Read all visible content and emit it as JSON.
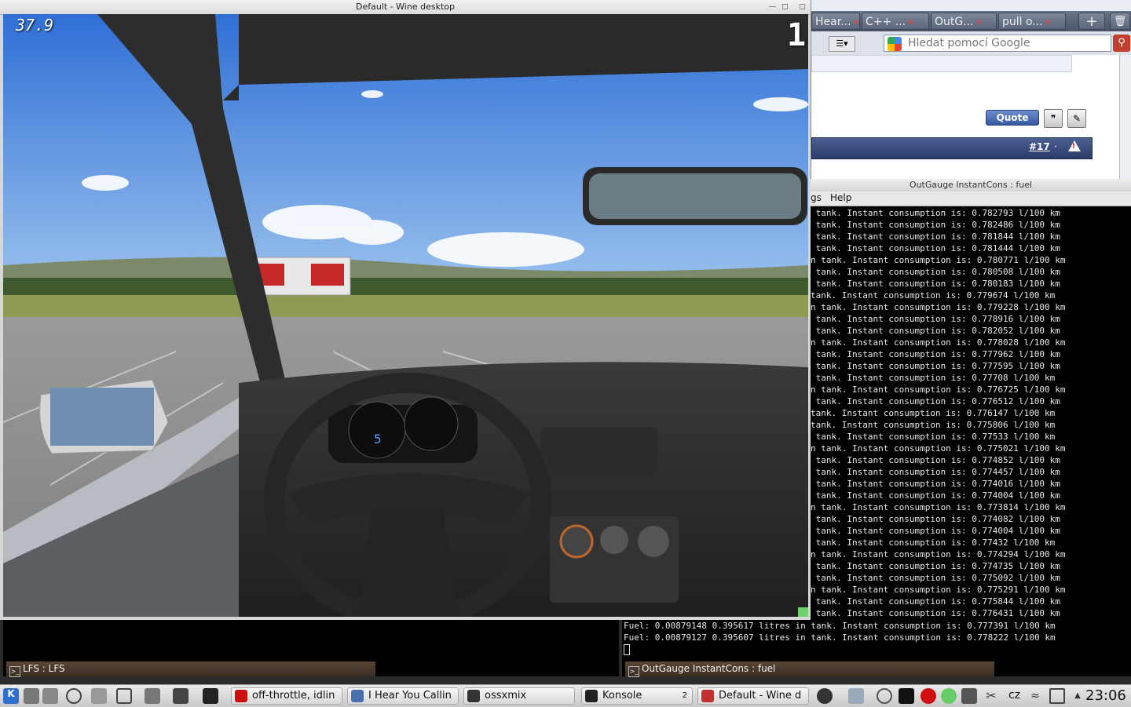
{
  "wine": {
    "title": "Default - Wine desktop",
    "hud": {
      "fps": "37.9",
      "gear_top": "1",
      "gear_dash": "5"
    }
  },
  "browser": {
    "tabs": [
      "Hear...",
      "C++ ...",
      "OutG...",
      "pull o..."
    ],
    "search_placeholder": "Hledat pomocí Google",
    "quote_label": "Quote",
    "post_number": "#17",
    "post_sep": "·"
  },
  "konsole": {
    "title": "OutGauge InstantCons : fuel",
    "menu": [
      "gs",
      "Help"
    ],
    "lines": [
      " tank. Instant consumption is: 0.782793 l/100 km",
      " tank. Instant consumption is: 0.782486 l/100 km",
      " tank. Instant consumption is: 0.781844 l/100 km",
      " tank. Instant consumption is: 0.781444 l/100 km",
      "n tank. Instant consumption is: 0.780771 l/100 km",
      " tank. Instant consumption is: 0.780508 l/100 km",
      " tank. Instant consumption is: 0.780183 l/100 km",
      "tank. Instant consumption is: 0.779674 l/100 km",
      "n tank. Instant consumption is: 0.779228 l/100 km",
      " tank. Instant consumption is: 0.778916 l/100 km",
      " tank. Instant consumption is: 0.782052 l/100 km",
      "n tank. Instant consumption is: 0.778028 l/100 km",
      " tank. Instant consumption is: 0.777962 l/100 km",
      " tank. Instant consumption is: 0.777595 l/100 km",
      " tank. Instant consumption is: 0.77708 l/100 km",
      "n tank. Instant consumption is: 0.776725 l/100 km",
      " tank. Instant consumption is: 0.776512 l/100 km",
      "tank. Instant consumption is: 0.776147 l/100 km",
      "tank. Instant consumption is: 0.775806 l/100 km",
      " tank. Instant consumption is: 0.77533 l/100 km",
      "n tank. Instant consumption is: 0.775021 l/100 km",
      " tank. Instant consumption is: 0.774852 l/100 km",
      " tank. Instant consumption is: 0.774457 l/100 km",
      " tank. Instant consumption is: 0.774016 l/100 km",
      " tank. Instant consumption is: 0.774004 l/100 km",
      "n tank. Instant consumption is: 0.773814 l/100 km",
      " tank. Instant consumption is: 0.774082 l/100 km",
      " tank. Instant consumption is: 0.774004 l/100 km",
      " tank. Instant consumption is: 0.77432 l/100 km",
      "n tank. Instant consumption is: 0.774294 l/100 km",
      " tank. Instant consumption is: 0.774735 l/100 km",
      " tank. Instant consumption is: 0.775092 l/100 km",
      "n tank. Instant consumption is: 0.775291 l/100 km",
      " tank. Instant consumption is: 0.775844 l/100 km",
      " tank. Instant consumption is: 0.776431 l/100 km"
    ]
  },
  "term_right": {
    "lines": [
      "Fuel: 0.00879148 0.395617 litres in tank. Instant consumption is: 0.777391 l/100 km",
      "Fuel: 0.00879127 0.395607 litres in tank. Instant consumption is: 0.778222 l/100 km"
    ],
    "tab_label": "OutGauge InstantCons : fuel"
  },
  "term_left": {
    "tab_label": "LFS : LFS"
  },
  "taskbar": {
    "tasks": [
      {
        "label": "off-throttle, idlin",
        "icon_color": "#cc1010"
      },
      {
        "label": "I Hear You Callin",
        "icon_color": "#4a6fb0"
      },
      {
        "label": "ossxmix",
        "icon_color": "#333333"
      },
      {
        "label": "Konsole",
        "icon_color": "#222222",
        "count": "2"
      },
      {
        "label": "Default - Wine d",
        "icon_color": "#c03030"
      }
    ],
    "lang": "cz",
    "clock": "23:06"
  }
}
